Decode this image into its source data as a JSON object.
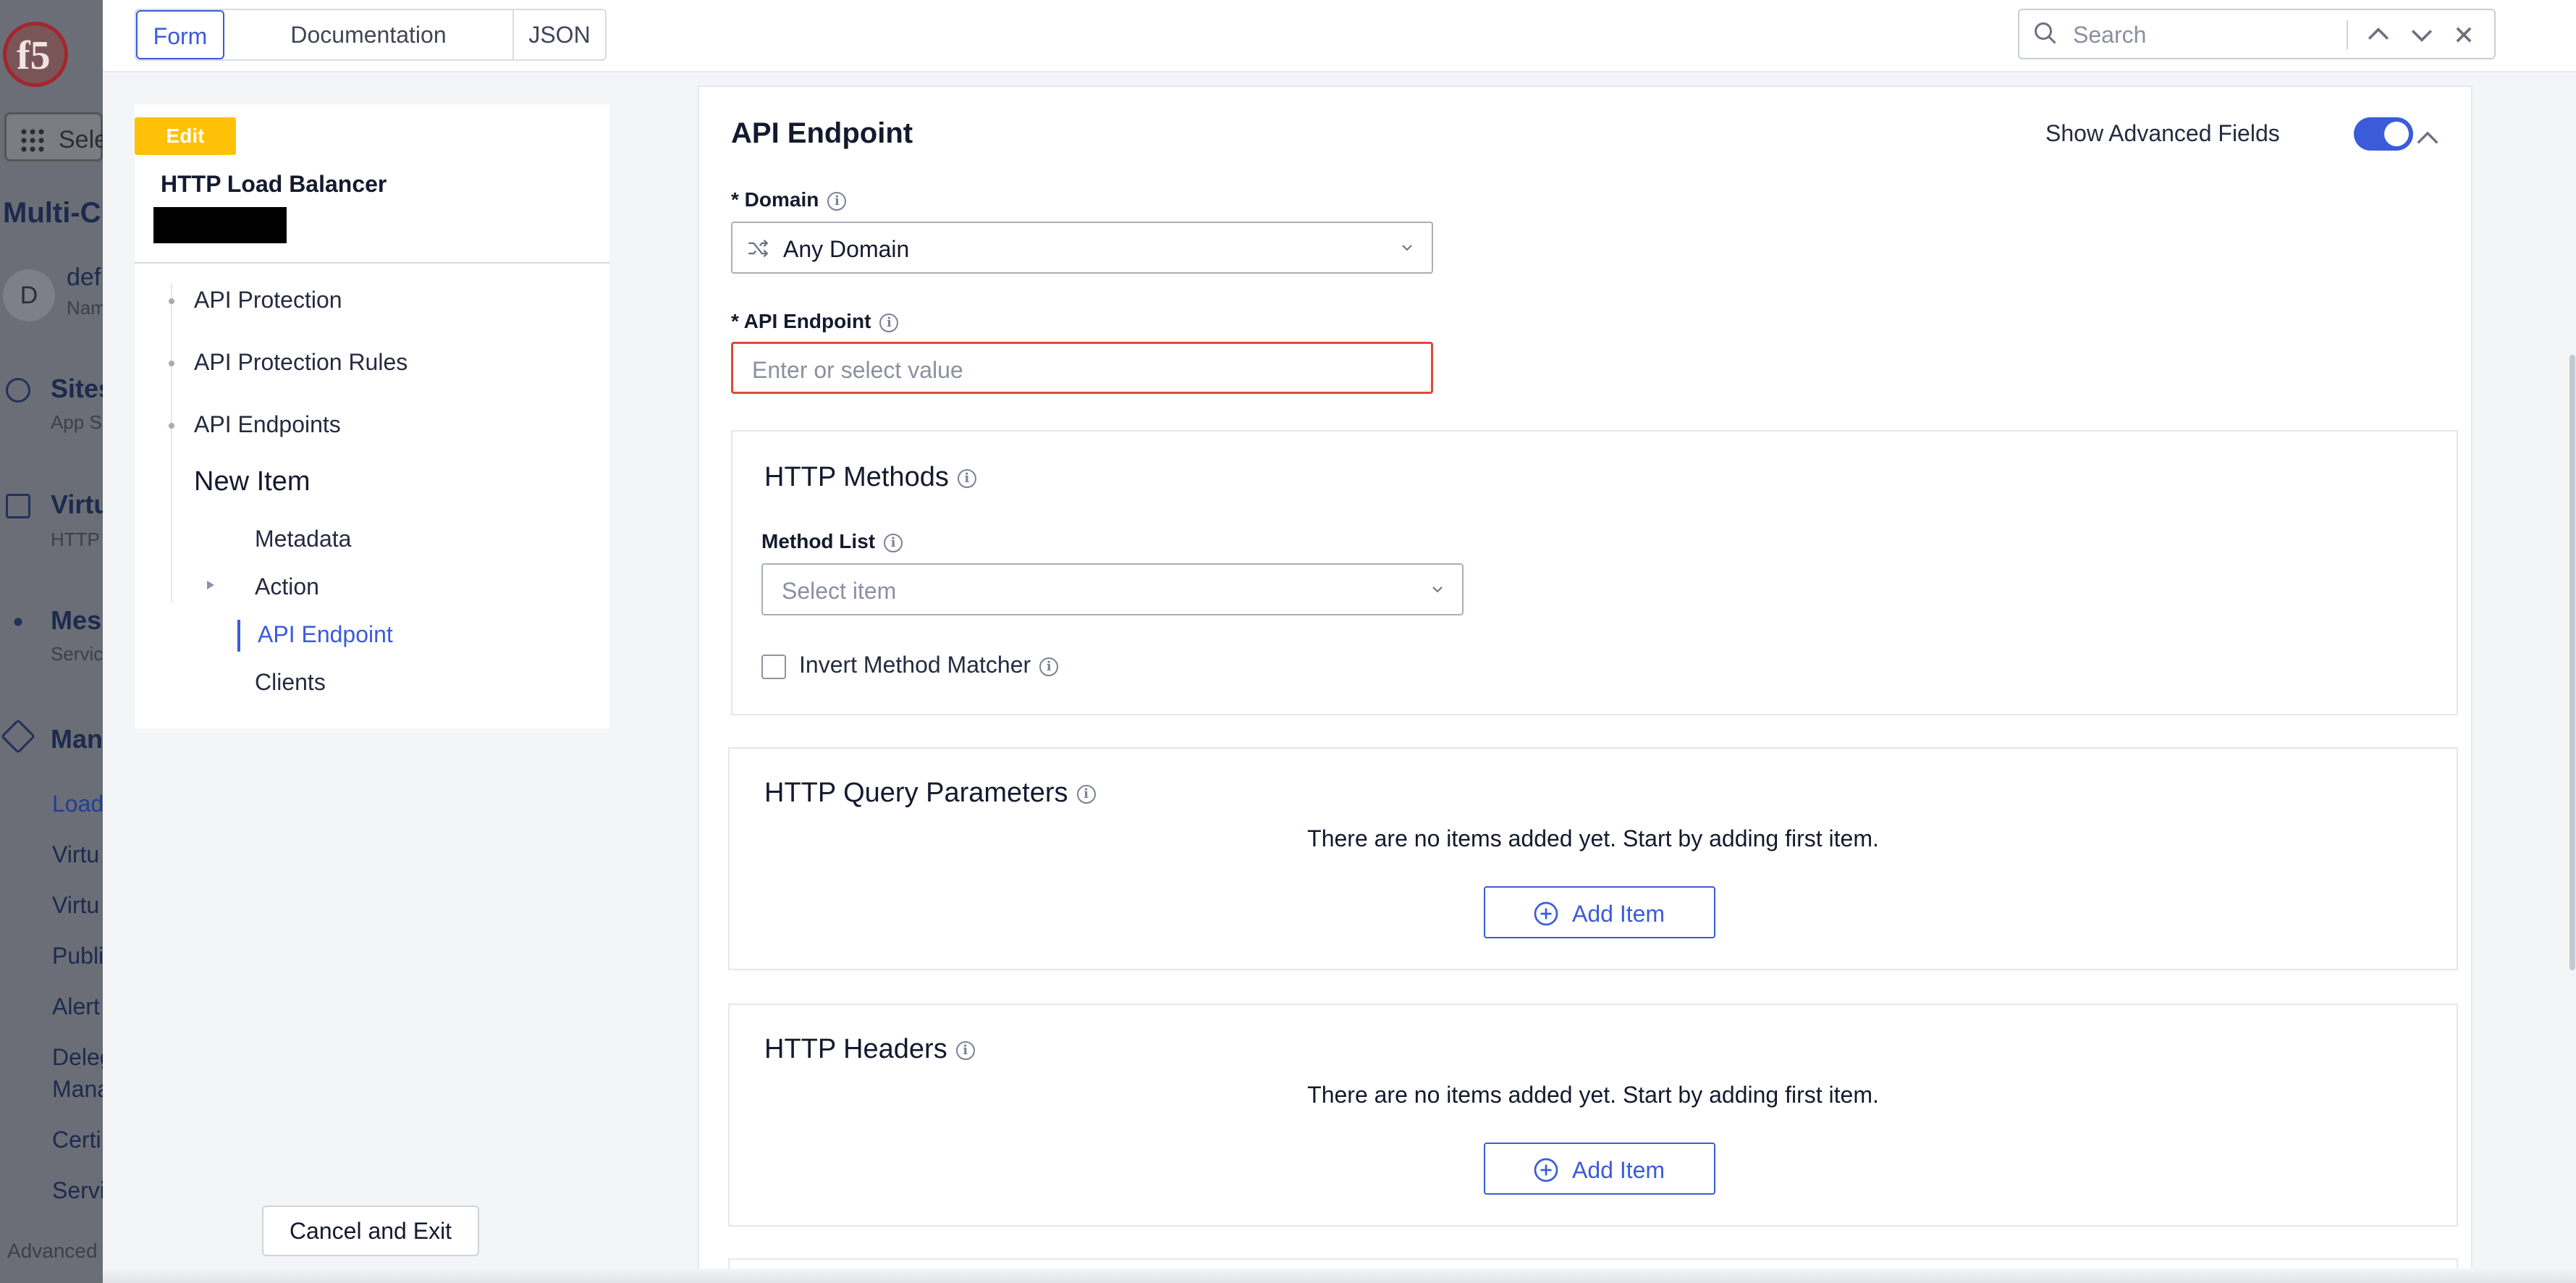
{
  "background": {
    "select_label": "Sele",
    "app_title": "Multi-C",
    "namespace_initial": "D",
    "namespace_name": "def",
    "namespace_sub": "Nam",
    "sites": "Sites",
    "sites_sub": "App S",
    "virtual": "Virtu",
    "virtual_sub": "HTTP",
    "mesh": "Mes",
    "mesh_sub": "Servic",
    "manage": "Man",
    "menu": [
      "Load",
      "Virtu",
      "Virtu",
      "Publi",
      "Alert",
      "Deleg",
      "Mana",
      "Certi",
      "Servi"
    ],
    "advanced": "Advanced"
  },
  "topbar": {
    "tabs": [
      "Form",
      "Documentation",
      "JSON"
    ],
    "search_placeholder": "Search"
  },
  "nav": {
    "badge": "Edit",
    "title": "HTTP Load Balancer",
    "items": [
      "API Protection",
      "API Protection Rules",
      "API Endpoints"
    ],
    "current": "New Item",
    "subitems": [
      "Metadata",
      "Action",
      "API Endpoint",
      "Clients"
    ],
    "cancel_label": "Cancel and Exit"
  },
  "form": {
    "section_title": "API Endpoint",
    "advanced_label": "Show Advanced Fields",
    "advanced_on": true,
    "domain_label": "* Domain",
    "domain_value": "Any Domain",
    "endpoint_label": "* API Endpoint",
    "endpoint_placeholder": "Enter or select value",
    "http_methods": {
      "title": "HTTP Methods",
      "method_list_label": "Method List",
      "method_placeholder": "Select item",
      "invert_label": "Invert Method Matcher"
    },
    "query_params": {
      "title": "HTTP Query Parameters",
      "empty": "There are no items added yet. Start by adding first item.",
      "add_label": "Add Item"
    },
    "headers": {
      "title": "HTTP Headers",
      "empty": "There are no items added yet. Start by adding first item.",
      "add_label": "Add Item"
    }
  },
  "colors": {
    "accent": "#3b5bdb",
    "badge": "#ffc107",
    "error": "#e0483c"
  }
}
